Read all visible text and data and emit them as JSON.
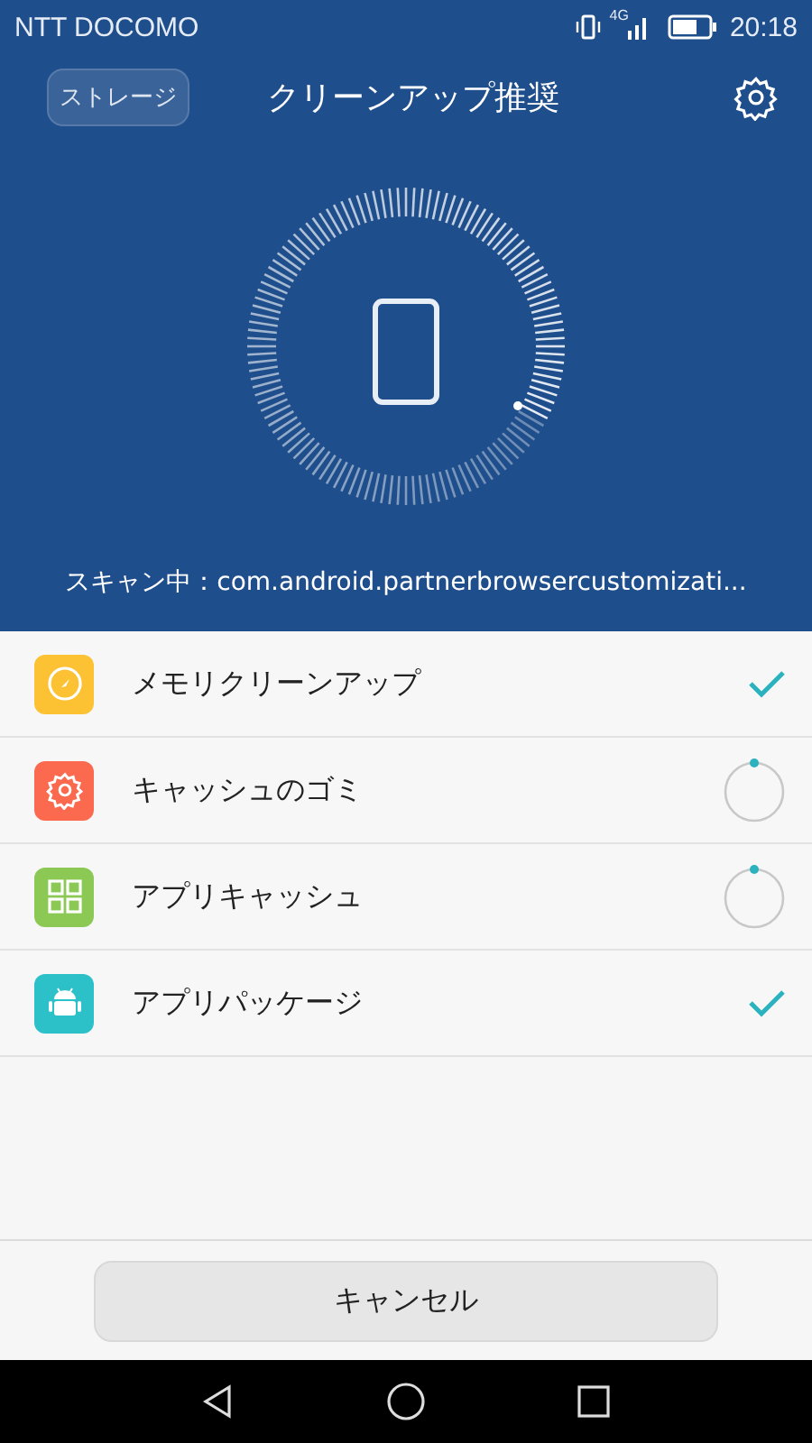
{
  "status_bar": {
    "carrier": "NTT DOCOMO",
    "network": "4G",
    "time": "20:18"
  },
  "header": {
    "storage_button": "ストレージ",
    "title": "クリーンアップ推奨"
  },
  "scan_status": "スキャン中：com.android.partnerbrowsercustomizati...",
  "items": [
    {
      "label": "メモリクリーンアップ",
      "kind": "memory",
      "color": "#fdc234",
      "done": true
    },
    {
      "label": "キャッシュのゴミ",
      "kind": "junk",
      "color": "#fb6a4f",
      "done": false
    },
    {
      "label": "アプリキャッシュ",
      "kind": "cache",
      "color": "#8bc854",
      "done": false
    },
    {
      "label": "アプリパッケージ",
      "kind": "package",
      "color": "#2cc0c9",
      "done": true
    }
  ],
  "cancel_button": "キャンセル"
}
